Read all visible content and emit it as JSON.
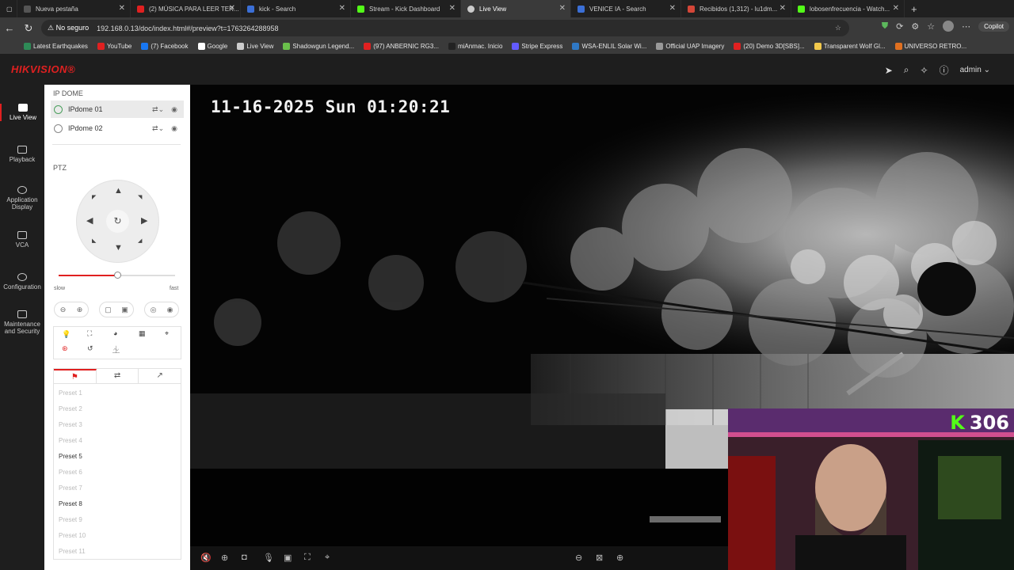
{
  "browser": {
    "tabs": [
      {
        "label": "Nueva pestaña",
        "color": "#555555"
      },
      {
        "label": "(2) MÚSICA PARA LEER TER...",
        "color": "#e02020"
      },
      {
        "label": "kick - Search",
        "color": "#3b6fd6"
      },
      {
        "label": "Stream - Kick Dashboard",
        "color": "#53fc18"
      },
      {
        "label": "Live View",
        "color": "#cccccc"
      },
      {
        "label": "VENICE IA - Search",
        "color": "#3b6fd6"
      },
      {
        "label": "Recibidos (1,312) - lu1dm...",
        "color": "#d44638"
      },
      {
        "label": "lobosenfrecuencia - Watch...",
        "color": "#53fc18"
      }
    ],
    "security_label": "No seguro",
    "url": "192.168.0.13/doc/index.html#/preview?t=1763264288958",
    "copilot_label": "Copilot",
    "bookmarks": [
      {
        "label": "Latest Earthquakes",
        "color": "#2e8b57"
      },
      {
        "label": "YouTube",
        "color": "#e02020"
      },
      {
        "label": "(7) Facebook",
        "color": "#1877f2"
      },
      {
        "label": "Google",
        "color": "#ffffff"
      },
      {
        "label": "Live View",
        "color": "#cccccc"
      },
      {
        "label": "Shadowgun Legend...",
        "color": "#6abf4b"
      },
      {
        "label": "(97) ANBERNIC RG3...",
        "color": "#e02020"
      },
      {
        "label": "miAnmac. Inicio",
        "color": "#222222"
      },
      {
        "label": "Stripe Express",
        "color": "#635bff"
      },
      {
        "label": "WSA-ENLIL Solar Wi...",
        "color": "#2f78c4"
      },
      {
        "label": "Official UAP Imagery",
        "color": "#999999"
      },
      {
        "label": "(20) Demo 3D[SBS]...",
        "color": "#e02020"
      },
      {
        "label": "Transparent Wolf Gl...",
        "color": "#f2c94c"
      },
      {
        "label": "UNIVERSO RETRO...",
        "color": "#e07020"
      }
    ]
  },
  "app": {
    "brand": "HIKVISION",
    "user": "admin",
    "nav": [
      {
        "label": "Live View"
      },
      {
        "label": "Playback"
      },
      {
        "label": "Application Display"
      },
      {
        "label": "VCA"
      },
      {
        "label": "Configuration"
      },
      {
        "label": "Maintenance and Security"
      }
    ],
    "group_title": "IP DOME",
    "cameras": [
      "IPdome 01",
      "IPdome 02"
    ],
    "ptz_title": "PTZ",
    "speed": {
      "slow": "slow",
      "fast": "fast",
      "level": 0.5
    },
    "presets": [
      "Preset 1",
      "Preset 2",
      "Preset 3",
      "Preset 4",
      "Preset 5",
      "Preset 6",
      "Preset 7",
      "Preset 8",
      "Preset 9",
      "Preset 10",
      "Preset 11"
    ],
    "presets_set": [
      5,
      8
    ]
  },
  "video": {
    "osd": "11-16-2025 Sun 01:20:21"
  },
  "overlay": {
    "viewer_count": "306"
  },
  "colors": {
    "accent": "#e02020",
    "kick": "#53fc18"
  }
}
